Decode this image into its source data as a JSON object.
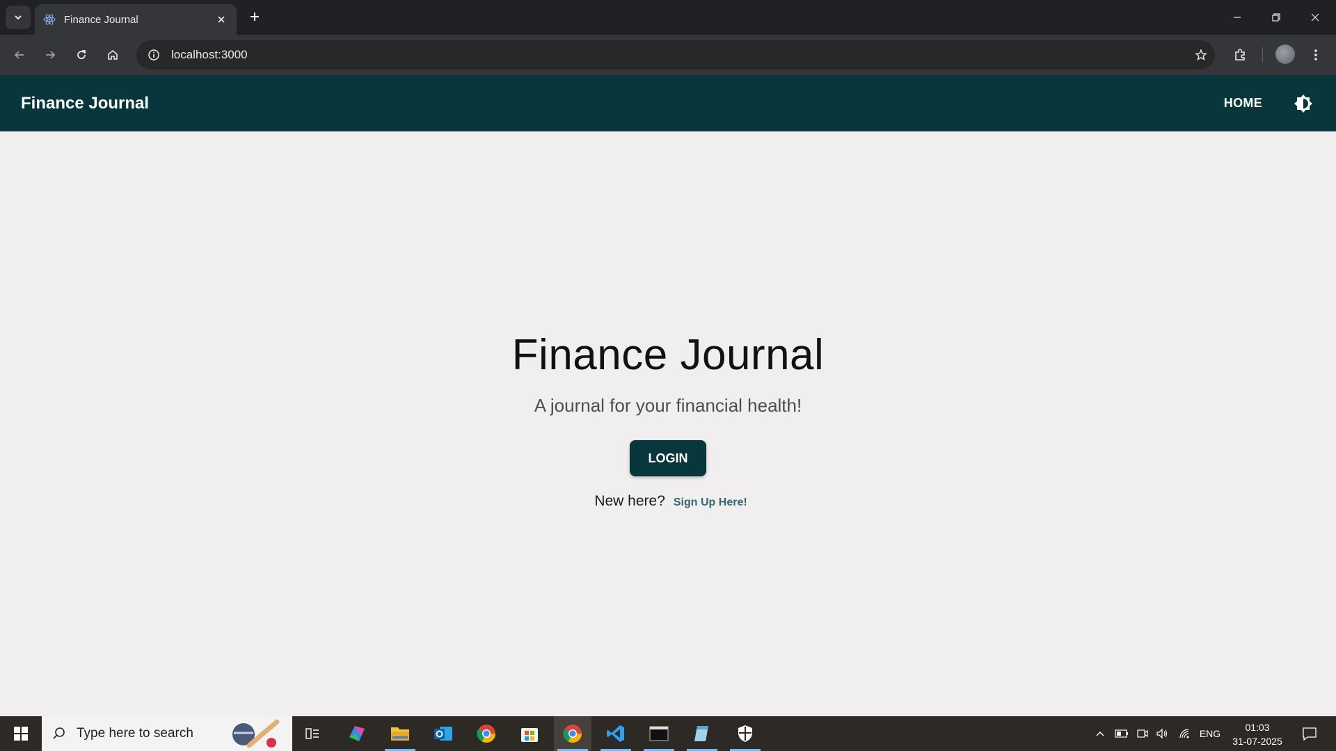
{
  "browser": {
    "tab_title": "Finance Journal",
    "url": "localhost:3000"
  },
  "app": {
    "brand": "Finance Journal",
    "nav_home": "HOME"
  },
  "hero": {
    "title": "Finance Journal",
    "subtitle": "A journal for your financial health!",
    "login_label": "LOGIN",
    "new_here": "New here?",
    "signup_link": "Sign Up Here!"
  },
  "taskbar": {
    "search_placeholder": "Type here to search",
    "language": "ENG",
    "time": "01:03",
    "date": "31-07-2025",
    "apps": [
      "task-view",
      "m365-copilot",
      "file-explorer",
      "outlook",
      "chrome",
      "microsoft-store",
      "chrome-active",
      "vscode",
      "terminal",
      "notepad",
      "security"
    ]
  },
  "colors": {
    "header_bg": "#07373d",
    "page_bg": "#f0eeee",
    "link": "#2f6a72",
    "browser_dark": "#202124"
  }
}
